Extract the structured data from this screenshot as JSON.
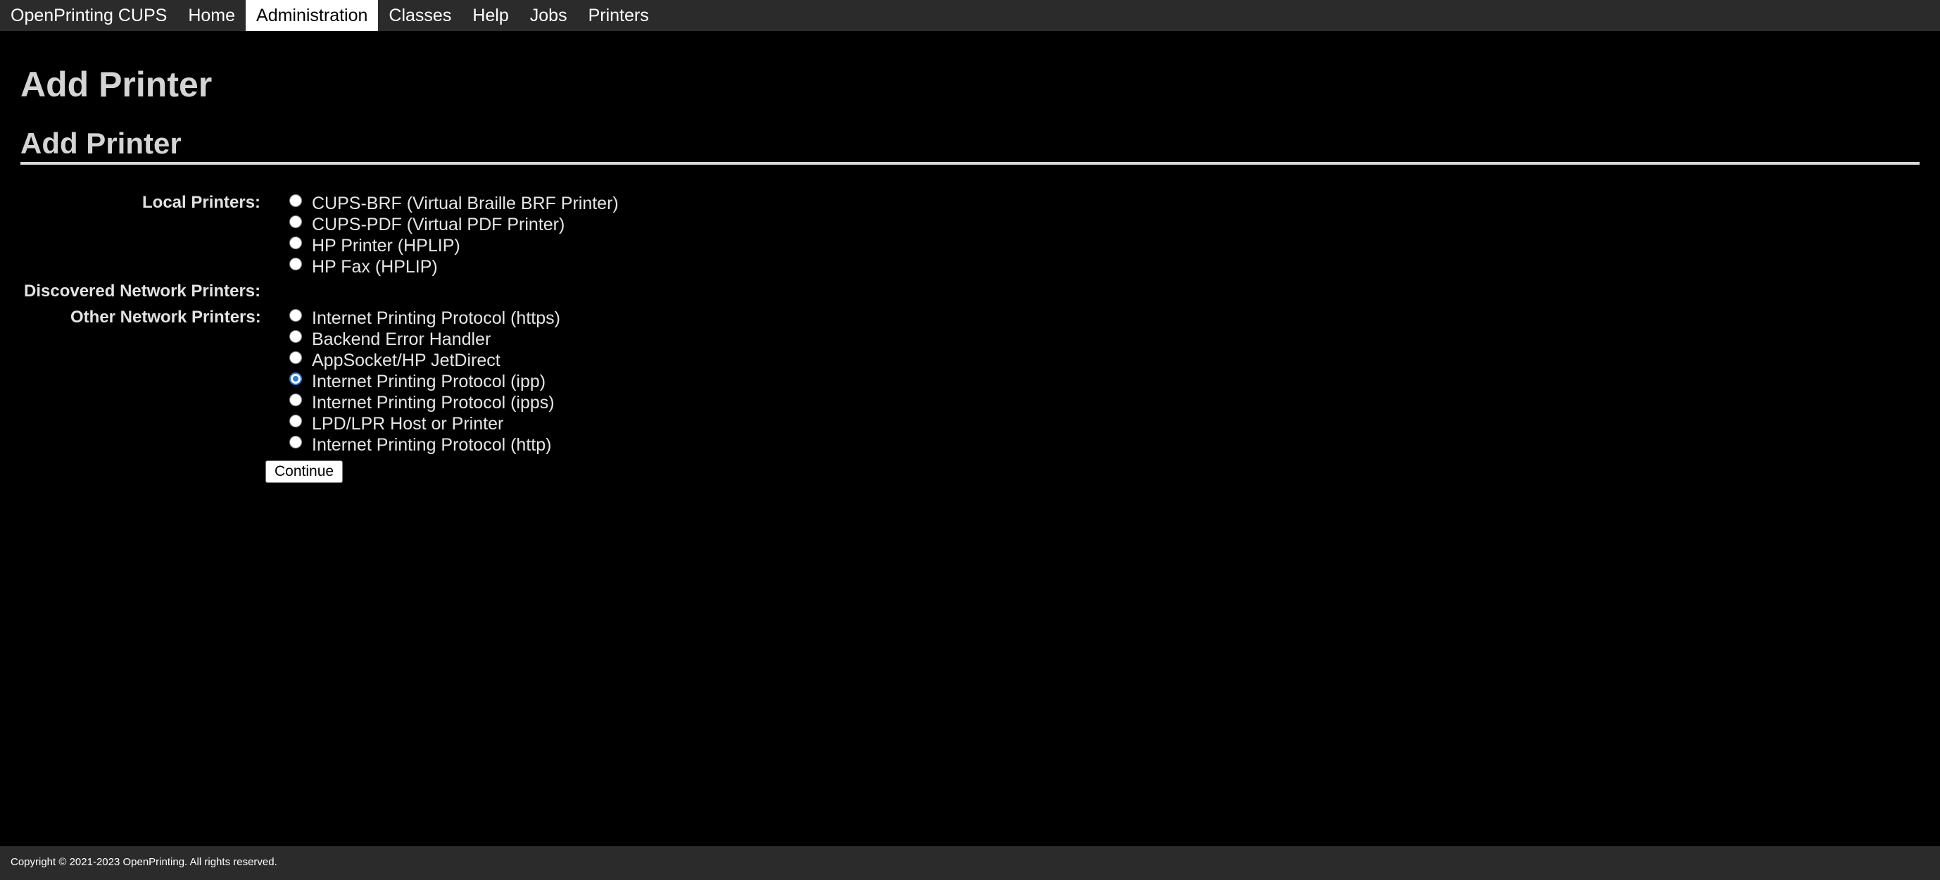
{
  "nav": {
    "items": [
      {
        "label": "OpenPrinting CUPS",
        "active": false
      },
      {
        "label": "Home",
        "active": false
      },
      {
        "label": "Administration",
        "active": true
      },
      {
        "label": "Classes",
        "active": false
      },
      {
        "label": "Help",
        "active": false
      },
      {
        "label": "Jobs",
        "active": false
      },
      {
        "label": "Printers",
        "active": false
      }
    ]
  },
  "page": {
    "title": "Add Printer",
    "section_title": "Add Printer"
  },
  "form": {
    "local_label": "Local Printers:",
    "local_printers": [
      {
        "label": "CUPS-BRF (Virtual Braille BRF Printer)",
        "checked": false
      },
      {
        "label": "CUPS-PDF (Virtual PDF Printer)",
        "checked": false
      },
      {
        "label": "HP Printer (HPLIP)",
        "checked": false
      },
      {
        "label": "HP Fax (HPLIP)",
        "checked": false
      }
    ],
    "discovered_label": "Discovered Network Printers:",
    "other_label": "Other Network Printers:",
    "other_printers": [
      {
        "label": "Internet Printing Protocol (https)",
        "checked": false
      },
      {
        "label": "Backend Error Handler",
        "checked": false
      },
      {
        "label": "AppSocket/HP JetDirect",
        "checked": false
      },
      {
        "label": "Internet Printing Protocol (ipp)",
        "checked": true
      },
      {
        "label": "Internet Printing Protocol (ipps)",
        "checked": false
      },
      {
        "label": "LPD/LPR Host or Printer",
        "checked": false
      },
      {
        "label": "Internet Printing Protocol (http)",
        "checked": false
      }
    ],
    "continue_label": "Continue"
  },
  "footer": {
    "copyright": "Copyright © 2021-2023 OpenPrinting. All rights reserved."
  },
  "colors": {
    "background": "#000000",
    "navbar": "#2b2b2b",
    "active_tab": "#ffffff",
    "radio_selected": "#2f7bd6"
  }
}
